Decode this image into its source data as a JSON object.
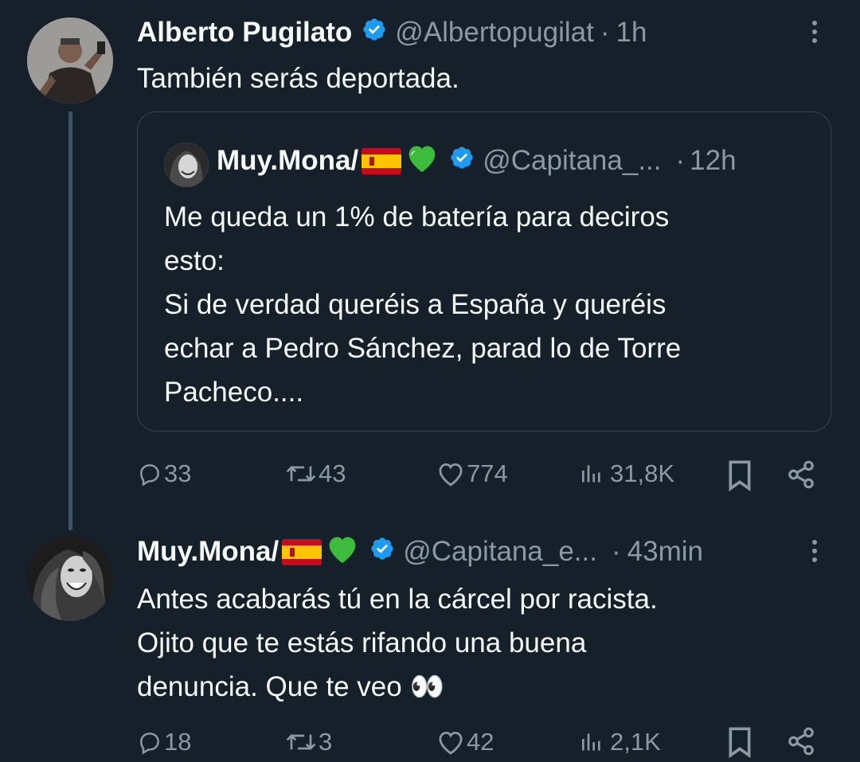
{
  "tweets": [
    {
      "author_name": "Alberto Pugilato",
      "handle": "@Albertopugilat",
      "separator": "·",
      "time": "1h",
      "text": "También serás deportada.",
      "quoted": {
        "author_name": "Muy.Mona/",
        "handle": "@Capitana_...",
        "separator": "·",
        "time": "12h",
        "text": "Me queda un 1% de batería para deciros\nesto:\nSi de verdad queréis a España y queréis\nechar a Pedro Sánchez, parad lo de Torre\nPacheco...."
      },
      "stats": {
        "replies": "33",
        "retweets": "43",
        "likes": "774",
        "views": "31,8K"
      }
    },
    {
      "author_name": "Muy.Mona/",
      "handle": "@Capitana_e...",
      "separator": "·",
      "time": "43min",
      "text": "Antes acabarás tú en la cárcel por racista.\nOjito que te estás rifando una buena\ndenuncia. Que te veo 👀",
      "stats": {
        "replies": "18",
        "retweets": "3",
        "likes": "42",
        "views": "2,1K"
      }
    }
  ],
  "colors": {
    "background": "#15202b",
    "text_primary": "#f7f9f9",
    "text_secondary": "#8b98a5",
    "verified": "#1d9bf0",
    "border": "#38444d"
  },
  "icons": [
    "verified-badge-icon",
    "spain-flag-icon",
    "green-heart-icon",
    "more-options-icon",
    "reply-icon",
    "retweet-icon",
    "like-icon",
    "views-icon",
    "bookmark-icon",
    "share-icon"
  ]
}
